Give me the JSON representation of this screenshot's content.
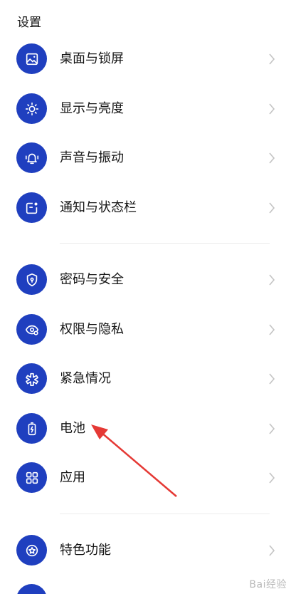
{
  "header": {
    "title": "设置"
  },
  "items": [
    {
      "label": "桌面与锁屏",
      "icon": "wallpaper-icon"
    },
    {
      "label": "显示与亮度",
      "icon": "brightness-icon"
    },
    {
      "label": "声音与振动",
      "icon": "bell-icon"
    },
    {
      "label": "通知与状态栏",
      "icon": "notification-icon"
    },
    {
      "label": "密码与安全",
      "icon": "shield-icon"
    },
    {
      "label": "权限与隐私",
      "icon": "privacy-eye-icon"
    },
    {
      "label": "紧急情况",
      "icon": "emergency-icon"
    },
    {
      "label": "电池",
      "icon": "battery-icon"
    },
    {
      "label": "应用",
      "icon": "apps-grid-icon"
    },
    {
      "label": "特色功能",
      "icon": "star-icon"
    }
  ],
  "colors": {
    "icon_background": "#1f3fbf",
    "annotation_arrow": "#e53935"
  },
  "watermark": "Bai经验"
}
